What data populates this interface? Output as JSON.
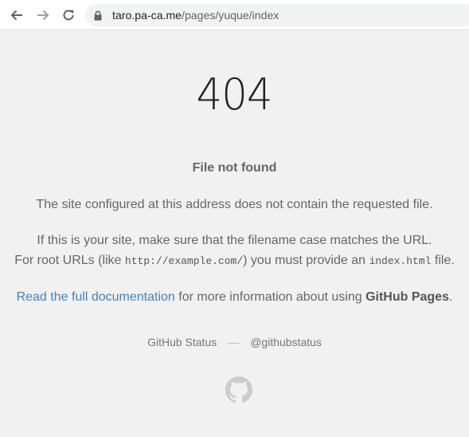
{
  "browser": {
    "url_host": "taro.pa-ca.me",
    "url_path": "/pages/yuque/index",
    "back_icon": "arrow-left-icon",
    "forward_icon": "arrow-right-icon",
    "reload_icon": "reload-icon",
    "lock_icon": "lock-icon"
  },
  "page": {
    "code": "404",
    "headline": "File not found",
    "message1": "The site configured at this address does not contain the requested file.",
    "message2": {
      "line1": "If this is your site, make sure that the filename case matches the URL.",
      "line2_prefix": "For root URLs (like ",
      "line2_code1": "http://example.com/",
      "line2_middle": ") you must provide an ",
      "line2_code2": "index.html",
      "line2_suffix": " file."
    },
    "message3": {
      "link": "Read the full documentation",
      "middle": " for more information about using ",
      "strong": "GitHub Pages",
      "suffix": "."
    },
    "footer": {
      "status_link": "GitHub Status",
      "separator": "—",
      "twitter_link": "@githubstatus"
    },
    "logo_icon": "github-octocat-icon"
  },
  "colors": {
    "background": "#f1f1f1",
    "link": "#4183c4",
    "text": "#666666"
  }
}
